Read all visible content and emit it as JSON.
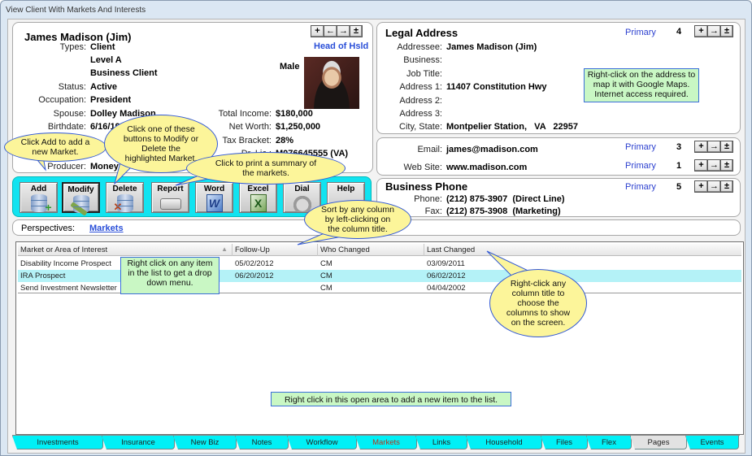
{
  "window": {
    "title": "View Client With Markets And Interests"
  },
  "client": {
    "name": "James Madison (Jim)",
    "head_of_household": "Head of Hsld",
    "gender": "Male",
    "nav_buttons": [
      "+",
      "←",
      "→",
      "±"
    ],
    "fields_left": [
      {
        "label": "Types:",
        "value": "Client"
      },
      {
        "label": "",
        "value": "Level A"
      },
      {
        "label": "",
        "value": "Business Client"
      },
      {
        "label": "Status:",
        "value": "Active"
      },
      {
        "label": "Occupation:",
        "value": "President"
      },
      {
        "label": "Spouse:",
        "value": "Dolley Madison"
      },
      {
        "label": "Birthdate:",
        "value": "6/16/19"
      },
      {
        "label": "",
        "value": ""
      },
      {
        "label": "Producer:",
        "value": "Moneym"
      }
    ],
    "fields_right": [
      {
        "label": "Total Income:",
        "value": "$180,000"
      },
      {
        "label": "Net Worth:",
        "value": "$1,250,000"
      },
      {
        "label": "Tax Bracket:",
        "value": "28%"
      },
      {
        "label": "Dr. Lic.:",
        "value": "M076645555 (VA)"
      }
    ]
  },
  "legal_address": {
    "title": "Legal Address",
    "primary": "Primary",
    "count": "4",
    "nav_buttons": [
      "+",
      "→",
      "±"
    ],
    "fields": [
      {
        "label": "Addressee:",
        "value": "James Madison (Jim)"
      },
      {
        "label": "Business:",
        "value": ""
      },
      {
        "label": "Job Title:",
        "value": ""
      },
      {
        "label": "Address 1:",
        "value": "11407 Constitution Hwy"
      },
      {
        "label": "Address 2:",
        "value": ""
      },
      {
        "label": "Address 3:",
        "value": ""
      },
      {
        "label": "City, State:",
        "value": "Montpelier Station,   VA   22957"
      }
    ],
    "note": "Right-click on the address to map it with Google Maps. Internet access required."
  },
  "contact": {
    "email": {
      "label": "Email:",
      "value": "james@madison.com",
      "primary": "Primary",
      "count": "3"
    },
    "web": {
      "label": "Web Site:",
      "value": "www.madison.com",
      "primary": "Primary",
      "count": "1"
    },
    "nav_buttons": [
      "+",
      "→",
      "±"
    ]
  },
  "phone": {
    "title": "Business Phone",
    "primary": "Primary",
    "count": "5",
    "nav_buttons": [
      "+",
      "→",
      "±"
    ],
    "fields": [
      {
        "label": "Phone:",
        "value": "(212) 875-3907  (Direct Line)"
      },
      {
        "label": "Fax:",
        "value": "(212) 875-3908  (Marketing)"
      }
    ]
  },
  "toolbar": {
    "buttons": [
      {
        "label": "Add",
        "icon": "database-add-icon"
      },
      {
        "label": "Modify",
        "icon": "database-edit-icon"
      },
      {
        "label": "Delete",
        "icon": "database-delete-icon"
      },
      {
        "label": "Report",
        "icon": "printer-icon"
      },
      {
        "label": "Word",
        "icon": "word-icon"
      },
      {
        "label": "Excel",
        "icon": "excel-icon"
      },
      {
        "label": "Dial",
        "icon": "phone-icon"
      },
      {
        "label": "Help",
        "icon": "help-icon"
      }
    ]
  },
  "perspectives": {
    "label": "Perspectives:",
    "value": "Markets"
  },
  "list": {
    "columns": [
      "Market or Area of Interest",
      "Follow-Up",
      "Who Changed",
      "Last Changed"
    ],
    "rows": [
      {
        "market": "Disability Income Prospect",
        "follow_up": "05/02/2012",
        "who": "CM",
        "last": "03/09/2011",
        "selected": false
      },
      {
        "market": "IRA Prospect",
        "follow_up": "06/20/2012",
        "who": "CM",
        "last": "06/02/2012",
        "selected": true
      },
      {
        "market": "Send Investment Newsletter",
        "follow_up": "",
        "who": "CM",
        "last": "04/04/2002",
        "selected": false
      }
    ]
  },
  "notes": {
    "list_item": "Right click on any item in the list to get a drop down menu.",
    "open_area": "Right click in this open area to add a new item to the list."
  },
  "callouts": {
    "add": "Click Add to add a new Market.",
    "modify_delete": "Click one of these buttons to Modify or Delete the highlighted Market.",
    "report": "Click to print a summary of the markets.",
    "sort": "Sort by any column by left-clicking on the column title.",
    "columns": "Right-click any column title to choose the columns to show on the screen."
  },
  "tabs": [
    {
      "label": "Investments",
      "active": false
    },
    {
      "label": "Insurance",
      "active": false
    },
    {
      "label": "New Biz",
      "active": false
    },
    {
      "label": "Notes",
      "active": false
    },
    {
      "label": "Workflow",
      "active": false
    },
    {
      "label": "Markets",
      "active": true
    },
    {
      "label": "Links",
      "active": false
    },
    {
      "label": "Household",
      "active": false
    },
    {
      "label": "Files",
      "active": false
    },
    {
      "label": "Flex",
      "active": false
    },
    {
      "label": "Pages",
      "active": false
    },
    {
      "label": "Events",
      "active": false
    }
  ]
}
